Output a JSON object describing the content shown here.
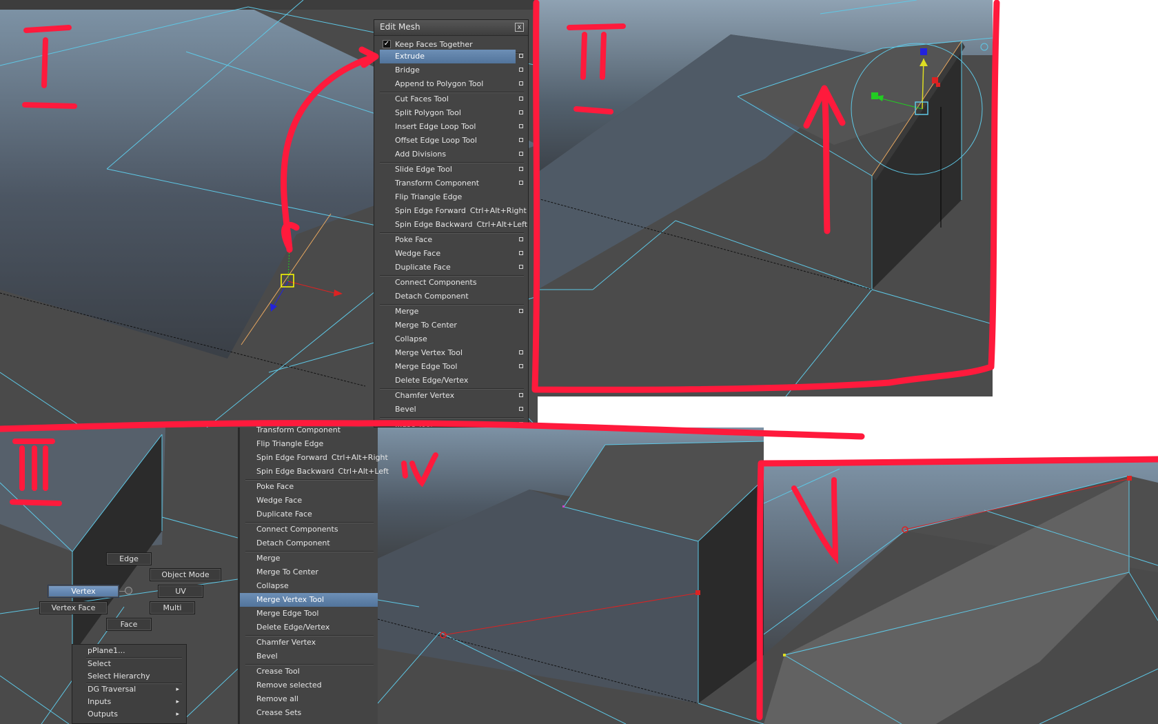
{
  "edit_mesh_menu": {
    "title": "Edit Mesh",
    "close_glyph": "x",
    "keep_faces_together": "Keep Faces Together",
    "keep_faces_checked": true,
    "items": [
      {
        "label": "Extrude",
        "option_box": true,
        "highlighted": true
      },
      {
        "label": "Bridge",
        "option_box": true
      },
      {
        "label": "Append to Polygon Tool",
        "option_box": true
      },
      {
        "label": "Cut Faces Tool",
        "option_box": true
      },
      {
        "label": "Split Polygon Tool",
        "option_box": true
      },
      {
        "label": "Insert Edge Loop Tool",
        "option_box": true
      },
      {
        "label": "Offset Edge Loop Tool",
        "option_box": true
      },
      {
        "label": "Add Divisions",
        "option_box": true
      },
      {
        "label": "Slide Edge Tool",
        "option_box": true
      },
      {
        "label": "Transform Component",
        "option_box": true
      },
      {
        "label": "Flip Triangle Edge",
        "option_box": false
      },
      {
        "label": "Spin Edge Forward",
        "shortcut": "Ctrl+Alt+Right",
        "option_box": false
      },
      {
        "label": "Spin Edge Backward",
        "shortcut": "Ctrl+Alt+Left",
        "option_box": false
      },
      {
        "label": "Poke Face",
        "option_box": true
      },
      {
        "label": "Wedge Face",
        "option_box": true
      },
      {
        "label": "Duplicate Face",
        "option_box": true
      },
      {
        "label": "Connect Components",
        "option_box": false
      },
      {
        "label": "Detach Component",
        "option_box": false
      },
      {
        "label": "Merge",
        "option_box": true
      },
      {
        "label": "Merge To Center",
        "option_box": false
      },
      {
        "label": "Collapse",
        "option_box": false
      },
      {
        "label": "Merge Vertex Tool",
        "option_box": true
      },
      {
        "label": "Merge Edge Tool",
        "option_box": true
      },
      {
        "label": "Delete Edge/Vertex",
        "option_box": false
      },
      {
        "label": "Chamfer Vertex",
        "option_box": true
      },
      {
        "label": "Bevel",
        "option_box": true
      },
      {
        "label": "...ase Tool",
        "option_box": true
      }
    ]
  },
  "panel_3_menu": {
    "items": [
      {
        "label": "Transform Component"
      },
      {
        "label": "Flip Triangle Edge"
      },
      {
        "label": "Spin Edge Forward",
        "shortcut": "Ctrl+Alt+Right"
      },
      {
        "label": "Spin Edge Backward",
        "shortcut": "Ctrl+Alt+Left"
      },
      {
        "label": "Poke Face"
      },
      {
        "label": "Wedge Face"
      },
      {
        "label": "Duplicate Face"
      },
      {
        "label": "Connect Components"
      },
      {
        "label": "Detach Component"
      },
      {
        "label": "Merge"
      },
      {
        "label": "Merge To Center"
      },
      {
        "label": "Collapse"
      },
      {
        "label": "Merge Vertex Tool",
        "highlighted": true
      },
      {
        "label": "Merge Edge Tool"
      },
      {
        "label": "Delete Edge/Vertex"
      },
      {
        "label": "Chamfer Vertex"
      },
      {
        "label": "Bevel"
      },
      {
        "label": "Crease Tool"
      },
      {
        "label": "Remove selected"
      },
      {
        "label": "Remove all"
      },
      {
        "label": "Crease Sets"
      }
    ]
  },
  "marking_menu": {
    "edge": "Edge",
    "object_mode": "Object Mode",
    "vertex": "Vertex",
    "uv": "UV",
    "vertex_face": "Vertex Face",
    "multi": "Multi",
    "face": "Face",
    "selected": "Vertex"
  },
  "context_menu": {
    "items": [
      {
        "label": "pPlane1..."
      },
      {
        "label": "Select"
      },
      {
        "label": "Select Hierarchy"
      },
      {
        "label": "DG Traversal",
        "submenu": true
      },
      {
        "label": "Inputs",
        "submenu": true
      },
      {
        "label": "Outputs",
        "submenu": true
      }
    ]
  },
  "annotations": {
    "step_1": "I",
    "step_2": "II",
    "step_3": "III",
    "step_4": "IV",
    "step_5": "V",
    "stroke_color": "#ff1a3c"
  },
  "colors": {
    "viewport_sky_top": "#8a9cac",
    "viewport_bottom": "#454545",
    "wire": "#5ec8e6",
    "menu_bg": "#444444",
    "highlight": "#5e80a8"
  }
}
